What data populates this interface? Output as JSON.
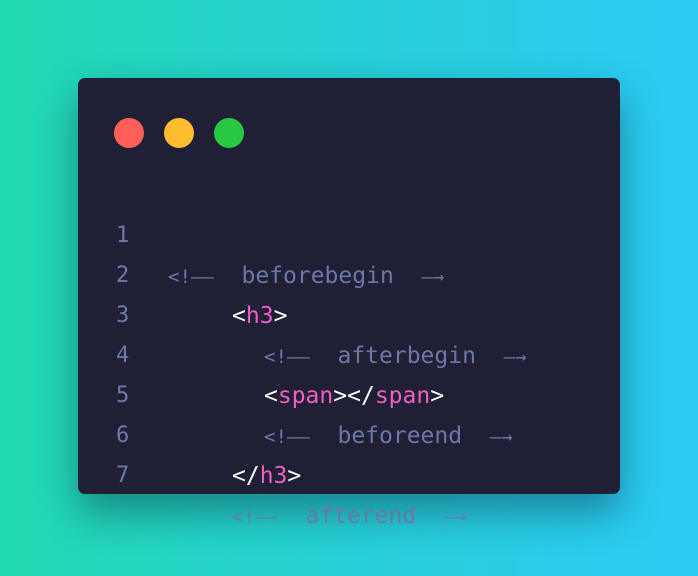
{
  "colors": {
    "background_start": "#21d9b0",
    "background_end": "#2bcbf6",
    "window": "#1f1f35",
    "dot_close": "#ff5f57",
    "dot_minimize": "#febc2e",
    "dot_maximize": "#28c840",
    "line_number": "#6e7aa8",
    "comment": "#6b78a7",
    "tag_name": "#f05fc4",
    "punctuation": "#ffffff"
  },
  "window_controls": [
    "close",
    "minimize",
    "maximize"
  ],
  "lines": [
    {
      "number": "1",
      "comment_open": "<!——",
      "comment_text": "beforebegin",
      "comment_close": "—→"
    },
    {
      "number": "2",
      "open_bracket": "<",
      "tag": "h3",
      "close_bracket": ">"
    },
    {
      "number": "3",
      "comment_open": "<!——",
      "comment_text": "afterbegin",
      "comment_close": "—→"
    },
    {
      "number": "4",
      "open_bracket": "<",
      "tag": "span",
      "close_bracket": ">",
      "end_open": "</",
      "end_tag": "span",
      "end_close": ">"
    },
    {
      "number": "5",
      "comment_open": "<!——",
      "comment_text": "beforeend",
      "comment_close": "—→"
    },
    {
      "number": "6",
      "end_open": "</",
      "tag": "h3",
      "close_bracket": ">"
    },
    {
      "number": "7",
      "comment_open": "<!——",
      "comment_text": "afterend",
      "comment_close": "—→"
    }
  ]
}
